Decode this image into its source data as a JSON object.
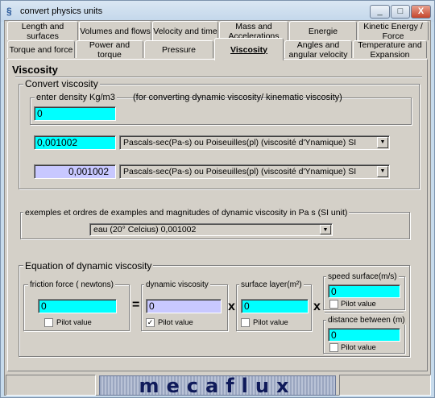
{
  "window": {
    "title": "convert physics units",
    "minimize": "_",
    "maximize": "□",
    "close": "X"
  },
  "tabs_row1": [
    "Length and surfaces",
    "Volumes and flows",
    "Velocity and time",
    "Mass and Accelerations",
    "Energie",
    "Kinetic Energy / Force"
  ],
  "tabs_row2": [
    "Torque and force",
    "Power and torque",
    "Pressure",
    "Viscosity",
    "Angles and angular velocity",
    "Temperature and Expansion"
  ],
  "panel_title": "Viscosity",
  "convert": {
    "legend": "Convert viscosity",
    "density_legend": "enter density Kg/m3",
    "density_note": "(for converting dynamic viscosity/ kinematic viscosity)",
    "density_value": "0",
    "input_value": "0,001002",
    "input_unit": "Pascals-sec(Pa-s) ou Poiseuilles(pl) (viscosité d'Ynamique)  SI",
    "output_value": "0,001002",
    "output_unit": "Pascals-sec(Pa-s) ou Poiseuilles(pl) (viscosité d'Ynamique)  SI"
  },
  "examples": {
    "legend": "exemples et ordres de examples and magnitudes of dynamic viscosity in Pa s (SI unit)",
    "selected": "eau (20° Celcius)             0,001002"
  },
  "equation": {
    "legend": "Equation of dynamic viscosity",
    "friction": {
      "label": "friction force ( newtons)",
      "value": "0",
      "pilot": "Pilot value",
      "checked": false
    },
    "dynamic": {
      "label": "dynamic viscosity",
      "value": "0",
      "pilot": "Pilot value",
      "checked": true
    },
    "surface": {
      "label": "surface layer(m²)",
      "value": "0",
      "pilot": "Pilot value",
      "checked": false
    },
    "speed": {
      "label": "speed surface(m/s)",
      "value": "0",
      "pilot": "Pilot value",
      "checked": false
    },
    "distance": {
      "label": "distance between (m)",
      "value": "0",
      "pilot": "Pilot value",
      "checked": false
    },
    "equals": "=",
    "times": "x"
  },
  "logo": "mecaflux"
}
